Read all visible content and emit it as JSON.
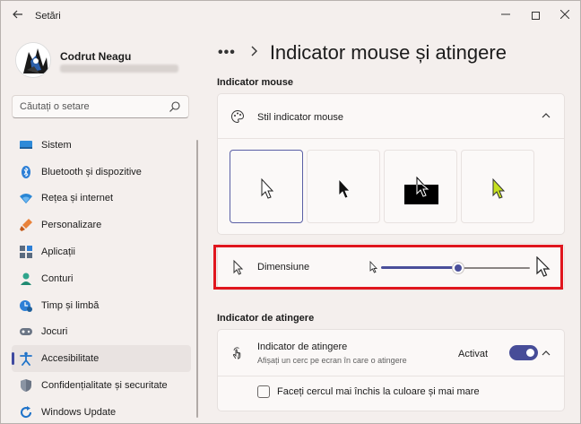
{
  "window": {
    "app_title": "Setări",
    "controls": [
      "minimize-icon",
      "maximize-icon",
      "close-icon"
    ]
  },
  "profile": {
    "name": "Codrut Neagu"
  },
  "search": {
    "placeholder": "Căutați o setare"
  },
  "sidebar": {
    "items": [
      {
        "label": "Sistem",
        "icon": "system-icon",
        "active": false
      },
      {
        "label": "Bluetooth și dispozitive",
        "icon": "bluetooth-icon",
        "active": false
      },
      {
        "label": "Rețea și internet",
        "icon": "wifi-icon",
        "active": false
      },
      {
        "label": "Personalizare",
        "icon": "brush-icon",
        "active": false
      },
      {
        "label": "Aplicații",
        "icon": "apps-icon",
        "active": false
      },
      {
        "label": "Conturi",
        "icon": "person-icon",
        "active": false
      },
      {
        "label": "Timp și limbă",
        "icon": "clock-globe-icon",
        "active": false
      },
      {
        "label": "Jocuri",
        "icon": "gamepad-icon",
        "active": false
      },
      {
        "label": "Accesibilitate",
        "icon": "accessibility-icon",
        "active": true
      },
      {
        "label": "Confidențialitate și securitate",
        "icon": "shield-icon",
        "active": false
      },
      {
        "label": "Windows Update",
        "icon": "update-icon",
        "active": false
      }
    ]
  },
  "main": {
    "breadcrumb_more": "•••",
    "title": "Indicator mouse și atingere",
    "mouse_section": "Indicator mouse",
    "style_row_label": "Stil indicator mouse",
    "style_options": [
      "white",
      "black",
      "inverted",
      "custom"
    ],
    "selected_style": "white",
    "size_label": "Dimensiune",
    "size_value_fraction": 0.47,
    "touch_section": "Indicator de atingere",
    "touch_title": "Indicator de atingere",
    "touch_subtitle": "Afișați un cerc pe ecran în care o atingere",
    "touch_toggle_label": "Activat",
    "touch_enabled": true,
    "checkbox_label": "Faceți cercul mai închis la culoare și mai mare",
    "checkbox_checked": false
  },
  "colors": {
    "accent": "#474d98",
    "highlight": "#e0161e",
    "custom_cursor": "#c5e020"
  }
}
